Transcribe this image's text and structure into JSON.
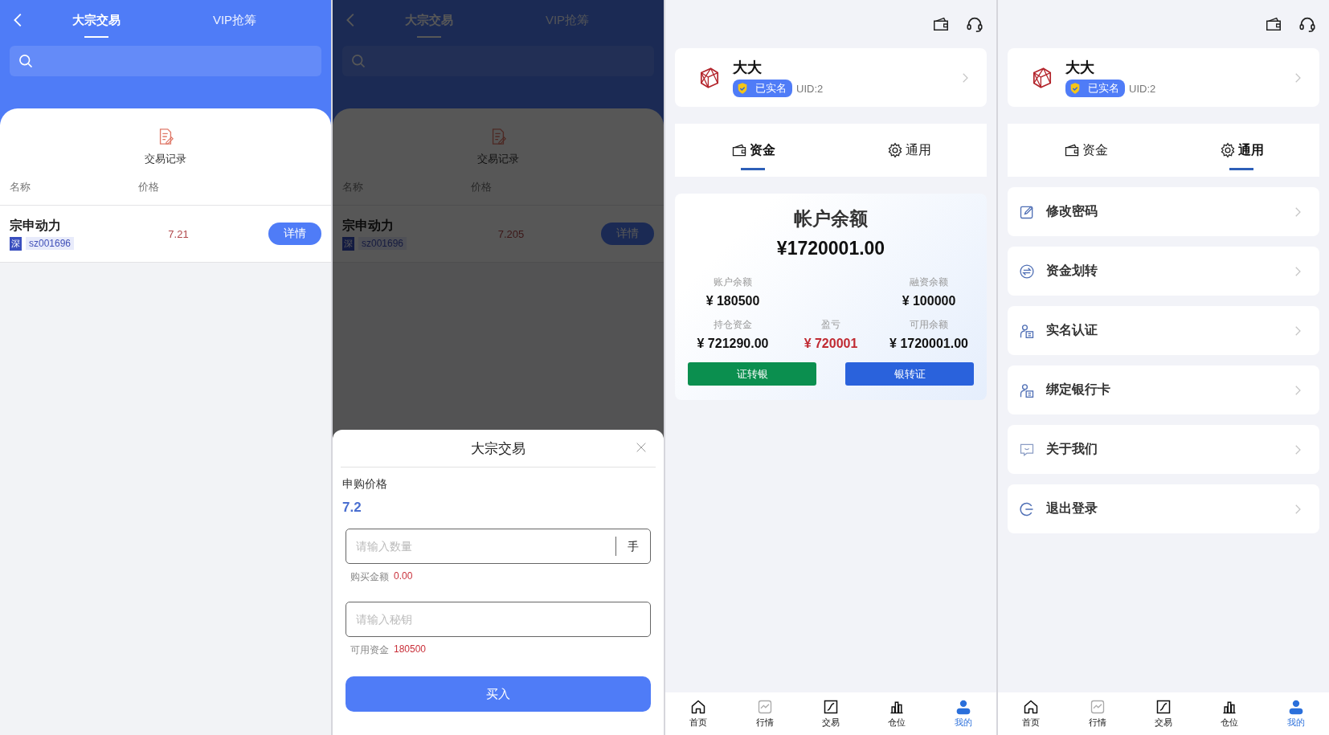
{
  "screens": [
    {
      "kind": "block_trade",
      "dimmed": false,
      "tabs": [
        {
          "label": "大宗交易",
          "selected": true
        },
        {
          "label": "VIP抢筹",
          "selected": false
        }
      ],
      "records_link": "交易记录",
      "table": {
        "columns": [
          "名称",
          "价格"
        ],
        "rows": [
          {
            "name": "宗申动力",
            "market": "深",
            "code": "sz001696",
            "price": "7.21",
            "action": "详情"
          }
        ]
      }
    },
    {
      "kind": "block_trade",
      "dimmed": true,
      "tabs": [
        {
          "label": "大宗交易",
          "selected": true
        },
        {
          "label": "VIP抢筹",
          "selected": false
        }
      ],
      "records_link": "交易记录",
      "table": {
        "columns": [
          "名称",
          "价格"
        ],
        "rows": [
          {
            "name": "宗申动力",
            "market": "深",
            "code": "sz001696",
            "price": "7.205",
            "action": "详情"
          }
        ]
      },
      "sheet": {
        "title": "大宗交易",
        "price_label": "申购价格",
        "price": "7.2",
        "quantity_field": {
          "placeholder": "请输入数量",
          "unit": "手"
        },
        "amount_label": "购买金额",
        "amount": "0.00",
        "key_field": {
          "placeholder": "请输入秘钥"
        },
        "available_label": "可用资金",
        "available": "180500",
        "submit": "买入"
      }
    },
    {
      "kind": "account",
      "profile": {
        "name": "大大",
        "badge": "已实名",
        "uid": "UID:2"
      },
      "tabs": [
        {
          "label": "资金",
          "selected": true
        },
        {
          "label": "通用",
          "selected": false
        }
      ],
      "balance": {
        "title": "帐户余额",
        "amount": "¥1720001.00",
        "stat_rows": [
          {
            "stats": [
              {
                "label": "账户余额",
                "value": "¥ 180500",
                "kind": "amount"
              },
              {
                "label": "融资余额",
                "value": "¥ 100000",
                "kind": "amount"
              }
            ]
          },
          {
            "stats": [
              {
                "label": "持仓资金",
                "value": "¥ 721290.00",
                "kind": "amount"
              },
              {
                "label": "盈亏",
                "value": "¥ 720001",
                "kind": "profit"
              },
              {
                "label": "可用余额",
                "value": "¥ 1720001.00",
                "kind": "amount"
              }
            ]
          }
        ],
        "buttons": [
          {
            "label": "证转银",
            "color": "#0b8f4f"
          },
          {
            "label": "银转证",
            "color": "#2a62dc"
          }
        ]
      },
      "nav": [
        {
          "label": "首页",
          "selected": false
        },
        {
          "label": "行情",
          "selected": false
        },
        {
          "label": "交易",
          "selected": false
        },
        {
          "label": "仓位",
          "selected": false
        },
        {
          "label": "我的",
          "selected": true
        }
      ]
    },
    {
      "kind": "account",
      "profile": {
        "name": "大大",
        "badge": "已实名",
        "uid": "UID:2"
      },
      "tabs": [
        {
          "label": "资金",
          "selected": false
        },
        {
          "label": "通用",
          "selected": true
        }
      ],
      "settings": [
        "修改密码",
        "资金划转",
        "实名认证",
        "绑定银行卡",
        "关于我们",
        "退出登录"
      ],
      "nav": [
        {
          "label": "首页",
          "selected": false
        },
        {
          "label": "行情",
          "selected": false
        },
        {
          "label": "交易",
          "selected": false
        },
        {
          "label": "仓位",
          "selected": false
        },
        {
          "label": "我的",
          "selected": true
        }
      ]
    }
  ]
}
